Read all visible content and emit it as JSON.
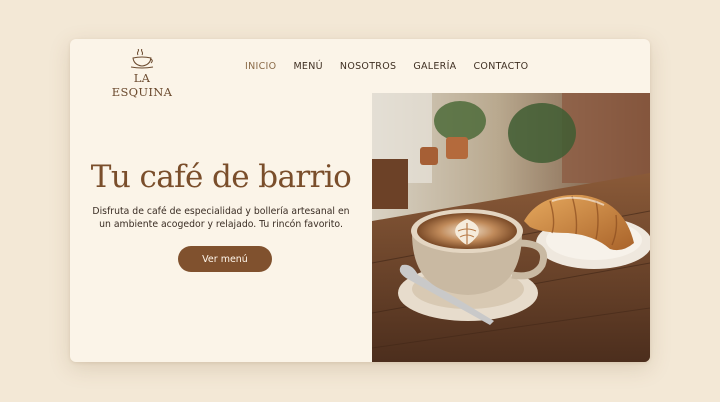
{
  "brand": {
    "name": "LA ESQUINA",
    "logo_icon": "coffee-cup-icon"
  },
  "nav": {
    "items": [
      {
        "label": "INICIO",
        "active": true
      },
      {
        "label": "MENÚ",
        "active": false
      },
      {
        "label": "NOSOTROS",
        "active": false
      },
      {
        "label": "GALERÍA",
        "active": false
      },
      {
        "label": "CONTACTO",
        "active": false
      }
    ]
  },
  "hero": {
    "title": "Tu café de barrio",
    "description": "Disfruta de café de especialidad y bollería artesanal en un ambiente acogedor y relajado. Tu rincón favorito.",
    "cta_label": "Ver menú"
  },
  "colors": {
    "page_background": "#f3e8d6",
    "card_background": "#fbf4e8",
    "accent": "#80512e",
    "title": "#7a4e2b",
    "nav_active": "#8a6a47"
  }
}
